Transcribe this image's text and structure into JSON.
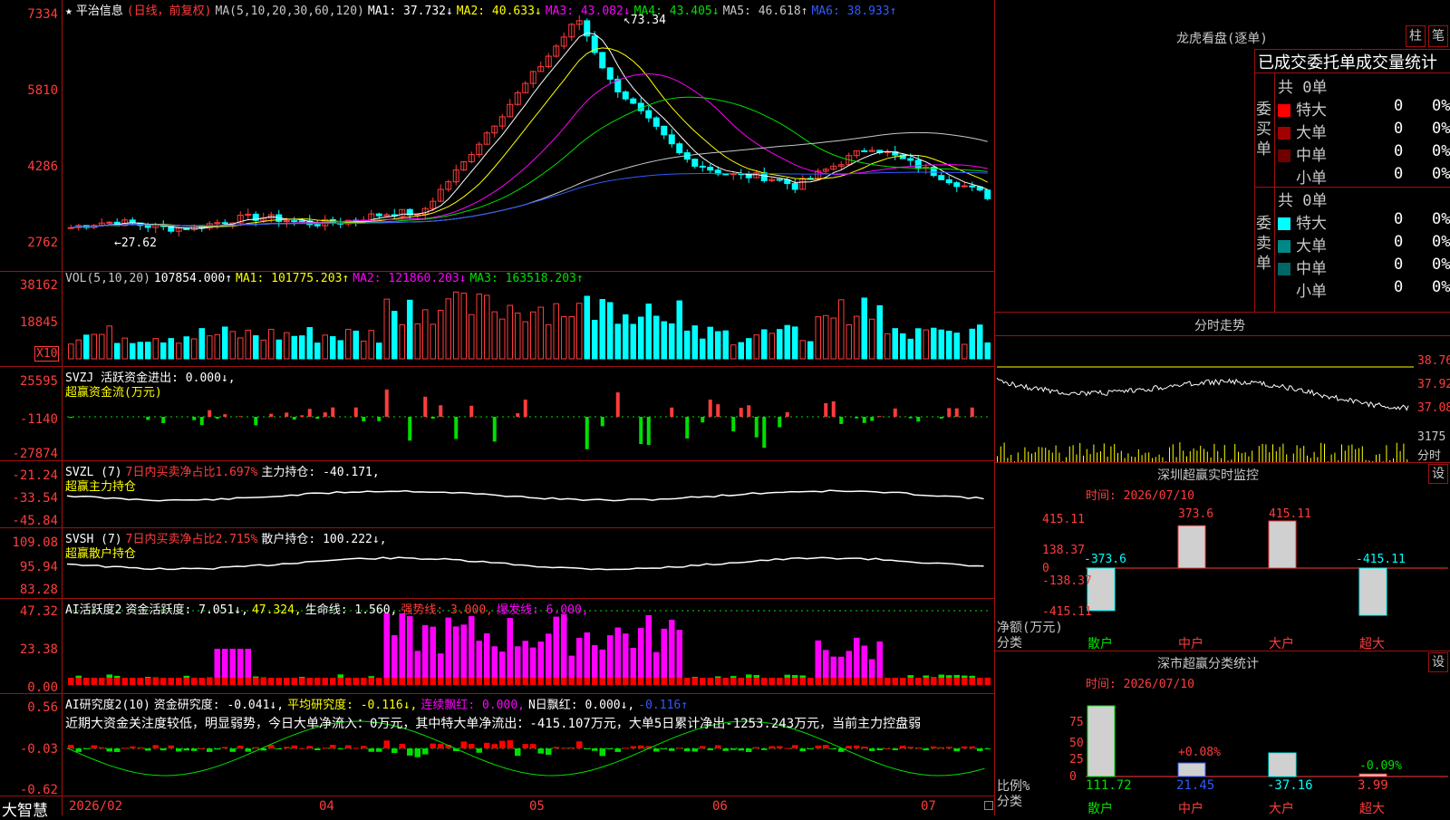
{
  "main": {
    "title": "平治信息",
    "period": "(日线，前复权)",
    "ma_params": "MA(5,10,20,30,60,120)",
    "ma": [
      {
        "label": "MA1: 37.732↓",
        "color": "#ffffff"
      },
      {
        "label": "MA2: 40.633↓",
        "color": "#ffff00"
      },
      {
        "label": "MA3: 43.082↓",
        "color": "#ff00ff"
      },
      {
        "label": "MA4: 43.405↓",
        "color": "#00e000"
      },
      {
        "label": "MA5: 46.618↑",
        "color": "#c8c8c8"
      },
      {
        "label": "MA6: 38.933↑",
        "color": "#2f5bff"
      }
    ],
    "y_labels": [
      "7334",
      "5810",
      "4286",
      "2762"
    ],
    "high_label": "73.34",
    "low_label": "27.62"
  },
  "vol": {
    "header": "VOL(5,10,20)",
    "value": "107854.000↑",
    "ma1": "MA1: 101775.203↑",
    "ma2": "MA2: 121860.203↓",
    "ma3": "MA3: 163518.203↑",
    "y_labels": [
      "38162",
      "18845"
    ],
    "unit": "X10"
  },
  "svzj": {
    "header": "SVZJ  活跃资金进出: 0.000↓,",
    "sub": "超赢资金流(万元)",
    "y_labels": [
      "25595",
      "-1140",
      "-27874"
    ]
  },
  "svzl": {
    "header_a": "SVZL (7)",
    "header_b": "7日内买卖净占比1.697%",
    "header_c": "主力持仓: -40.171,",
    "sub": "超赢主力持仓",
    "y_labels": [
      "-21.24",
      "-33.54",
      "-45.84"
    ]
  },
  "svsh": {
    "header_a": "SVSH (7)",
    "header_b": "7日内买卖净占比2.715%",
    "header_c": "散户持仓: 100.222↓,",
    "sub": "超赢散户持仓",
    "y_labels": [
      "109.08",
      "95.94",
      "83.28"
    ]
  },
  "ai1": {
    "header_a": "AI活跃度2",
    "header_b": "资金活跃度: 7.051↓,",
    "header_c": "47.324,",
    "header_d": "生命线: 1.560,",
    "header_e": "强势线: 3.000,",
    "header_f": "爆发线: 6.000,",
    "y_labels": [
      "47.32",
      "23.38",
      "0.00"
    ]
  },
  "ai2": {
    "header_a": "AI研究度2(10)",
    "header_b": "资金研究度: -0.041↓,",
    "header_c": "平均研究度: -0.116↓,",
    "header_d": "连续飘红: 0.000,",
    "header_e": "N日飘红: 0.000↓,",
    "header_f": "-0.116↑",
    "note": "近期大资金关注度较低，明显弱势，今日大单净流入：0万元，其中特大单净流出：-415.107万元，大单5日累计净出-1253.243万元，当前主力控盘弱",
    "y_labels": [
      "0.56",
      "-0.03",
      "-0.62"
    ]
  },
  "xaxis": {
    "brand": "大智慧",
    "labels": [
      "2026/02",
      "04",
      "05",
      "06",
      "07"
    ]
  },
  "right": {
    "title": "龙虎看盘(逐单)",
    "btn1": "柱",
    "btn2": "笔",
    "stat_title": "已成交委托单成交量统计",
    "buy_label": "委买单",
    "sell_label": "委卖单",
    "buy_total": "共 0单",
    "sell_total": "共 0单",
    "buy_rows": [
      {
        "name": "特大",
        "val": "0",
        "pct": "0%",
        "color": "#ff0000"
      },
      {
        "name": "大单",
        "val": "0",
        "pct": "0%",
        "color": "#a00000"
      },
      {
        "name": "中单",
        "val": "0",
        "pct": "0%",
        "color": "#700000"
      },
      {
        "name": "小单",
        "val": "0",
        "pct": "0%",
        "color": "#000000"
      }
    ],
    "sell_rows": [
      {
        "name": "特大",
        "val": "0",
        "pct": "0%",
        "color": "#00ffff"
      },
      {
        "name": "大单",
        "val": "0",
        "pct": "0%",
        "color": "#008888"
      },
      {
        "name": "中单",
        "val": "0",
        "pct": "0%",
        "color": "#006666"
      },
      {
        "name": "小单",
        "val": "0",
        "pct": "0%",
        "color": "#000000"
      }
    ],
    "intraday_title": "分时走势",
    "intraday_labels": [
      "38.76",
      "37.92",
      "37.08",
      "3175",
      "分时"
    ],
    "mon_title": "深圳超赢实时监控",
    "mon_btn": "设",
    "mon_time": "时间: 2026/07/10",
    "mon_y": [
      "415.11",
      "138.37",
      "0",
      "-138.37",
      "-415.11"
    ],
    "mon_bars": [
      {
        "name": "散户",
        "val": "-373.6"
      },
      {
        "name": "中户",
        "val": "373.6"
      },
      {
        "name": "大户",
        "val": "415.11"
      },
      {
        "name": "超大",
        "val": "-415.11"
      }
    ],
    "mon_unit": "净额(万元)",
    "mon_cat": "分类",
    "cls_title": "深市超赢分类统计",
    "cls_btn": "设",
    "cls_time": "时间: 2026/07/10",
    "cls_y": [
      "75",
      "50",
      "25",
      "0"
    ],
    "cls_vals": [
      "111.72",
      "21.45",
      "-37.16",
      "3.99"
    ],
    "cls_pcts": [
      "+0.08%",
      "-0.09%"
    ],
    "cls_unit": "比例%",
    "cls_cat": "分类",
    "cls_names": [
      "散户",
      "中户",
      "大户",
      "超大"
    ]
  }
}
